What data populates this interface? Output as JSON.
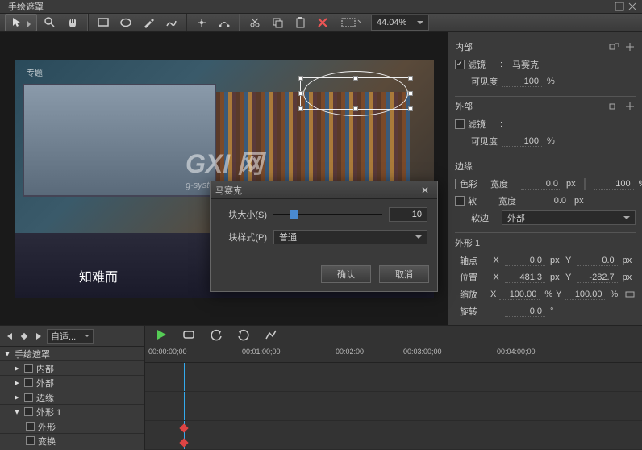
{
  "window": {
    "title": "手绘遮罩"
  },
  "toolbar": {
    "zoom": "44.04%"
  },
  "preview": {
    "caption": "知难而",
    "watermark": "GXI 网",
    "watermark_sub": "g-system.com",
    "corner_logo": "专题"
  },
  "props": {
    "inside": {
      "header": "内部",
      "filter_label": "滤镜",
      "filter_value": "马赛克",
      "filter_checked": true,
      "visibility_label": "可见度",
      "visibility_value": "100",
      "visibility_unit": "%"
    },
    "outside": {
      "header": "外部",
      "filter_label": "滤镜",
      "filter_checked": false,
      "visibility_label": "可见度",
      "visibility_value": "100",
      "visibility_unit": "%"
    },
    "edge": {
      "header": "边缘",
      "color_label": "色彩",
      "width_label": "宽度",
      "width1_value": "0.0",
      "width1_unit": "px",
      "pct_value": "100",
      "pct_unit": "%",
      "soft_label": "软",
      "width2_value": "0.0",
      "width2_unit": "px",
      "softedge_label": "软边",
      "softedge_value": "外部"
    },
    "shape": {
      "header": "外形 1",
      "anchor_label": "轴点",
      "x_label": "X",
      "y_label": "Y",
      "anchor_x": "0.0",
      "anchor_y": "0.0",
      "anchor_unit": "px",
      "position_label": "位置",
      "position_x": "481.3",
      "position_y": "-282.7",
      "position_unit": "px",
      "scale_label": "缩放",
      "scale_x": "100.00",
      "scale_y": "100.00",
      "scale_unit": "%",
      "rotation_label": "旋转",
      "rotation_value": "0.0",
      "rotation_unit": "°"
    }
  },
  "timeline": {
    "fit_label": "自适...",
    "ruler": [
      "00:00:00;00",
      "00:01:00;00",
      "00:02:00",
      "00:03:00;00",
      "00:04:00;00"
    ],
    "tracks": {
      "root": "手绘遮罩",
      "inside": "内部",
      "outside": "外部",
      "edge": "边缘",
      "shape1": "外形 1",
      "shape": "外形",
      "transform": "变换"
    }
  },
  "dialog": {
    "title": "马赛克",
    "block_size_label": "块大小(S)",
    "block_size_value": "10",
    "block_style_label": "块样式(P)",
    "block_style_value": "普通",
    "ok": "确认",
    "cancel": "取消"
  }
}
